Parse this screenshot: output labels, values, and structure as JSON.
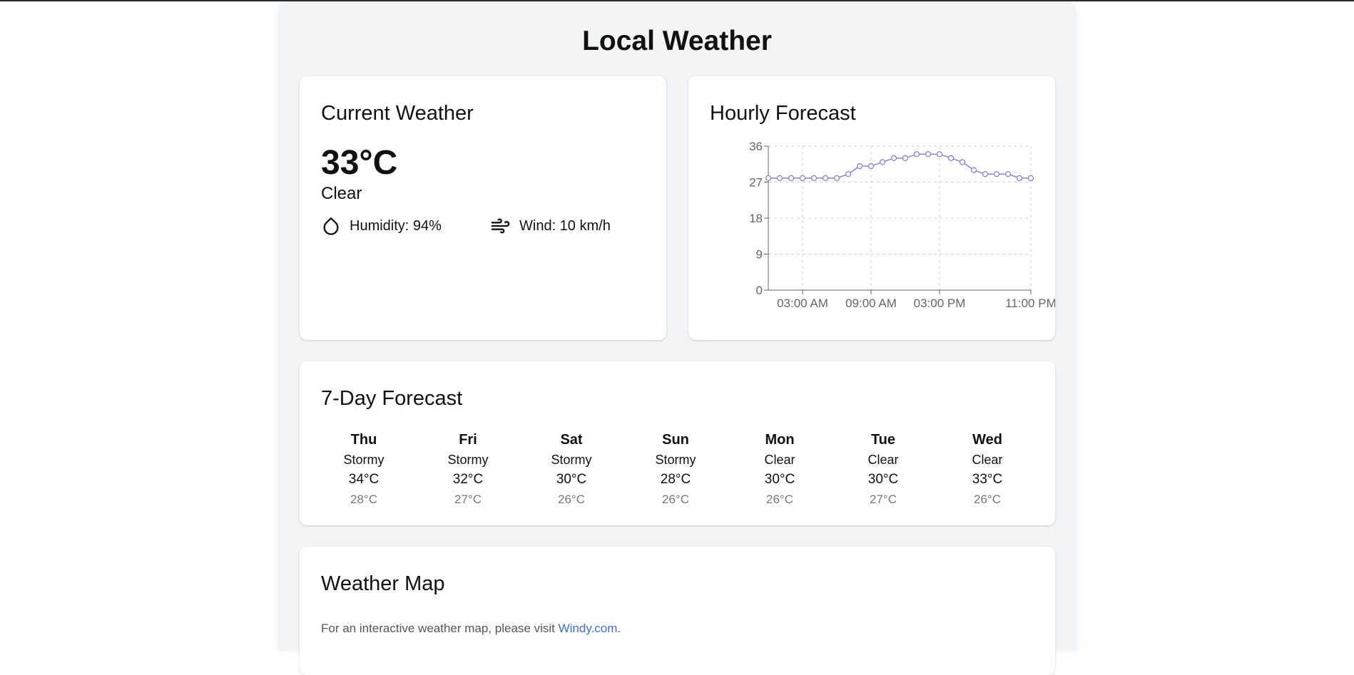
{
  "page": {
    "title": "Local Weather"
  },
  "current": {
    "title": "Current Weather",
    "temperature": "33°C",
    "condition": "Clear",
    "humidity": "Humidity: 94%",
    "wind": "Wind: 10 km/h",
    "humidity_icon": "droplet-icon",
    "wind_icon": "wind-icon"
  },
  "hourly": {
    "title": "Hourly Forecast"
  },
  "chart_data": {
    "type": "line",
    "title": "",
    "xlabel": "",
    "ylabel": "",
    "x": [
      "12:00 AM",
      "01:00 AM",
      "02:00 AM",
      "03:00 AM",
      "04:00 AM",
      "05:00 AM",
      "06:00 AM",
      "07:00 AM",
      "08:00 AM",
      "09:00 AM",
      "10:00 AM",
      "11:00 AM",
      "12:00 PM",
      "01:00 PM",
      "02:00 PM",
      "03:00 PM",
      "04:00 PM",
      "05:00 PM",
      "06:00 PM",
      "07:00 PM",
      "08:00 PM",
      "09:00 PM",
      "10:00 PM",
      "11:00 PM"
    ],
    "x_tick_labels": [
      "03:00 AM",
      "09:00 AM",
      "03:00 PM",
      "11:00 PM"
    ],
    "x_tick_indices": [
      3,
      9,
      15,
      23
    ],
    "series": [
      {
        "values": [
          28,
          28,
          28,
          28,
          28,
          28,
          28,
          29,
          31,
          31,
          32,
          33,
          33,
          34,
          34,
          34,
          33,
          32,
          30,
          29,
          29,
          29,
          28,
          28
        ]
      }
    ],
    "ylim": [
      0,
      36
    ],
    "yticks": [
      "0",
      "9",
      "18",
      "27",
      "36"
    ],
    "grid": true,
    "line_color": "#8884d8"
  },
  "forecast": {
    "title": "7-Day Forecast",
    "days": [
      {
        "day": "Thu",
        "condition": "Stormy",
        "high": "34°C",
        "low": "28°C"
      },
      {
        "day": "Fri",
        "condition": "Stormy",
        "high": "32°C",
        "low": "27°C"
      },
      {
        "day": "Sat",
        "condition": "Stormy",
        "high": "30°C",
        "low": "26°C"
      },
      {
        "day": "Sun",
        "condition": "Stormy",
        "high": "28°C",
        "low": "26°C"
      },
      {
        "day": "Mon",
        "condition": "Clear",
        "high": "30°C",
        "low": "26°C"
      },
      {
        "day": "Tue",
        "condition": "Clear",
        "high": "30°C",
        "low": "27°C"
      },
      {
        "day": "Wed",
        "condition": "Clear",
        "high": "33°C",
        "low": "26°C"
      }
    ]
  },
  "map": {
    "title": "Weather Map",
    "text_before": "For an interactive weather map, please visit ",
    "link_text": "Windy.com",
    "text_after": "."
  },
  "colors": {
    "accent": "#8884d8",
    "link": "#3b6fd8",
    "panel_bg": "#f3f4f6"
  }
}
